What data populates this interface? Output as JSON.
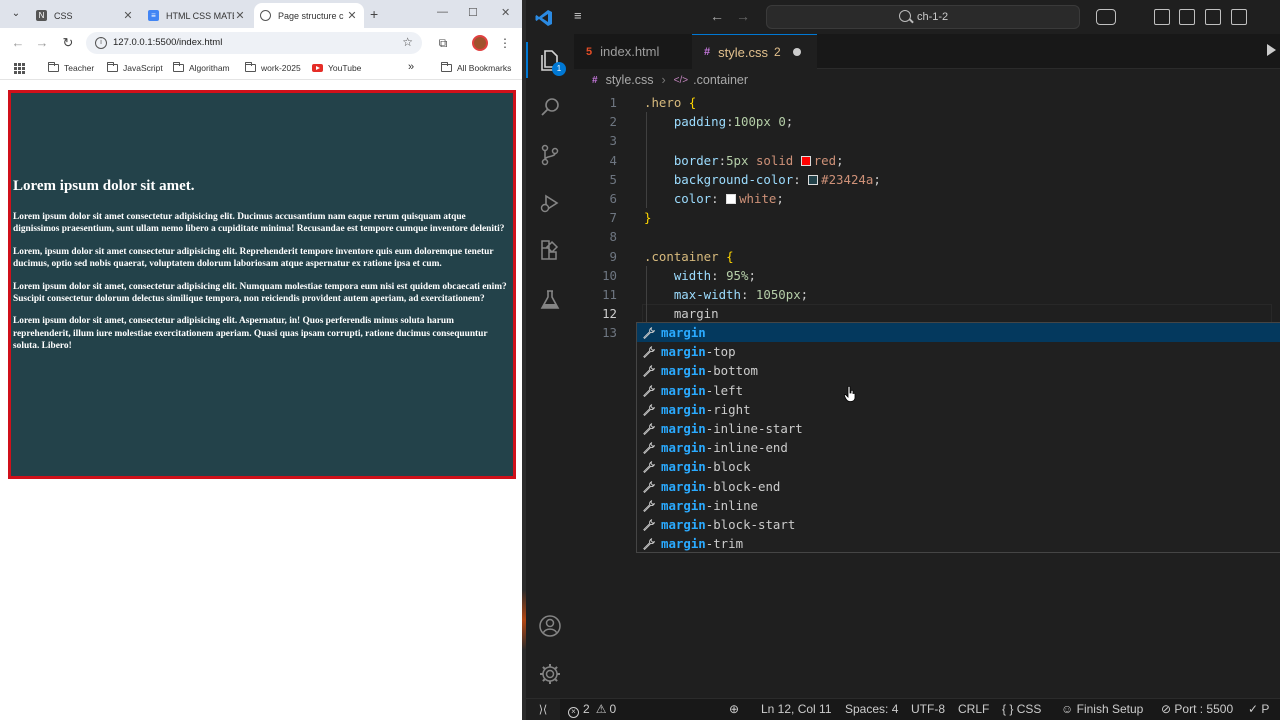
{
  "browser": {
    "tabs": [
      {
        "title": "CSS",
        "active": false
      },
      {
        "title": "HTML CSS MATE",
        "active": false
      },
      {
        "title": "Page structure c",
        "active": true
      }
    ],
    "url": "127.0.0.1:5500/index.html",
    "bookmarks": [
      "Teacher",
      "JavaScript",
      "Algoritham",
      "work-2025",
      "YouTube"
    ],
    "all_bookmarks": "All Bookmarks",
    "overflow": "»"
  },
  "page": {
    "heading": "Lorem ipsum dolor sit amet.",
    "paragraphs": [
      "Lorem ipsum dolor sit amet consectetur adipisicing elit. Ducimus accusantium nam eaque rerum quisquam atque dignissimos praesentium, sunt ullam nemo libero a cupiditate minima! Recusandae est tempore cumque inventore deleniti?",
      "Lorem, ipsum dolor sit amet consectetur adipisicing elit. Reprehenderit tempore inventore quis eum doloremque tenetur ducimus, optio sed nobis quaerat, voluptatem dolorum laboriosam atque aspernatur ex ratione ipsa et cum.",
      "Lorem ipsum dolor sit amet, consectetur adipisicing elit. Numquam molestiae tempora eum nisi est quidem obcaecati enim? Suscipit consectetur dolorum delectus similique tempora, non reiciendis provident autem aperiam, ad exercitationem?",
      "Lorem ipsum dolor sit amet, consectetur adipisicing elit. Aspernatur, in! Quos perferendis minus soluta harum reprehenderit, illum iure molestiae exercitationem aperiam. Quasi quas ipsam corrupti, ratione ducimus consequuntur soluta. Libero!"
    ],
    "colors": {
      "border": "#d0101a",
      "background": "#23424a",
      "text": "#ffffff"
    }
  },
  "vscode": {
    "search": "ch-1-2",
    "explorer_badge": "1",
    "tabs": [
      {
        "name": "index.html",
        "active": false
      },
      {
        "name": "style.css",
        "active": true,
        "problems": "2"
      }
    ],
    "breadcrumb": {
      "file": "style.css",
      "symbol": ".container"
    },
    "lines": [
      {
        "n": "1",
        "parts": [
          {
            "t": ".hero",
            "c": "sel"
          },
          {
            "t": " "
          },
          {
            "t": "{",
            "c": "brace"
          }
        ]
      },
      {
        "n": "2",
        "parts": [
          {
            "t": "    "
          },
          {
            "t": "padding",
            "c": "prop"
          },
          {
            "t": ":"
          },
          {
            "t": "100px",
            "c": "num"
          },
          {
            "t": " "
          },
          {
            "t": "0",
            "c": "num"
          },
          {
            "t": ";"
          }
        ]
      },
      {
        "n": "3",
        "parts": []
      },
      {
        "n": "4",
        "parts": [
          {
            "t": "    "
          },
          {
            "t": "border",
            "c": "prop"
          },
          {
            "t": ":"
          },
          {
            "t": "5px",
            "c": "num"
          },
          {
            "t": " "
          },
          {
            "t": "solid",
            "c": "val"
          },
          {
            "t": " "
          },
          {
            "swatch": "#ff0000"
          },
          {
            "t": "red",
            "c": "val"
          },
          {
            "t": ";"
          }
        ]
      },
      {
        "n": "5",
        "parts": [
          {
            "t": "    "
          },
          {
            "t": "background-color",
            "c": "prop"
          },
          {
            "t": ": "
          },
          {
            "swatch": "#23424a"
          },
          {
            "t": "#23424a",
            "c": "val"
          },
          {
            "t": ";"
          }
        ]
      },
      {
        "n": "6",
        "parts": [
          {
            "t": "    "
          },
          {
            "t": "color",
            "c": "prop"
          },
          {
            "t": ": "
          },
          {
            "swatch": "#ffffff"
          },
          {
            "t": "white",
            "c": "val"
          },
          {
            "t": ";"
          }
        ]
      },
      {
        "n": "7",
        "parts": [
          {
            "t": "}",
            "c": "brace"
          }
        ]
      },
      {
        "n": "8",
        "parts": []
      },
      {
        "n": "9",
        "parts": [
          {
            "t": ".container",
            "c": "sel"
          },
          {
            "t": " "
          },
          {
            "t": "{",
            "c": "brace"
          }
        ]
      },
      {
        "n": "10",
        "parts": [
          {
            "t": "    "
          },
          {
            "t": "width",
            "c": "prop"
          },
          {
            "t": ": "
          },
          {
            "t": "95%",
            "c": "num"
          },
          {
            "t": ";"
          }
        ]
      },
      {
        "n": "11",
        "parts": [
          {
            "t": "    "
          },
          {
            "t": "max-width",
            "c": "prop"
          },
          {
            "t": ": "
          },
          {
            "t": "1050px",
            "c": "num"
          },
          {
            "t": ";"
          }
        ]
      },
      {
        "n": "12",
        "parts": [
          {
            "t": "    margin"
          }
        ],
        "current": true
      },
      {
        "n": "13",
        "parts": []
      }
    ],
    "suggestions": [
      {
        "match": "margin",
        "rest": "",
        "focus": true
      },
      {
        "match": "margin",
        "rest": "-top"
      },
      {
        "match": "margin",
        "rest": "-bottom"
      },
      {
        "match": "margin",
        "rest": "-left"
      },
      {
        "match": "margin",
        "rest": "-right"
      },
      {
        "match": "margin",
        "rest": "-inline-start"
      },
      {
        "match": "margin",
        "rest": "-inline-end"
      },
      {
        "match": "margin",
        "rest": "-block"
      },
      {
        "match": "margin",
        "rest": "-block-end"
      },
      {
        "match": "margin",
        "rest": "-inline"
      },
      {
        "match": "margin",
        "rest": "-block-start"
      },
      {
        "match": "margin",
        "rest": "-trim"
      }
    ],
    "status": {
      "errors": "2",
      "warnings": "0",
      "position": "Ln 12, Col 11",
      "spaces": "Spaces: 4",
      "encoding": "UTF-8",
      "eol": "CRLF",
      "language": "CSS",
      "finish_setup": "Finish Setup",
      "port": "Port : 5500"
    },
    "colors": {
      "accent": "#0078d4",
      "match": "#2aaaff"
    }
  }
}
